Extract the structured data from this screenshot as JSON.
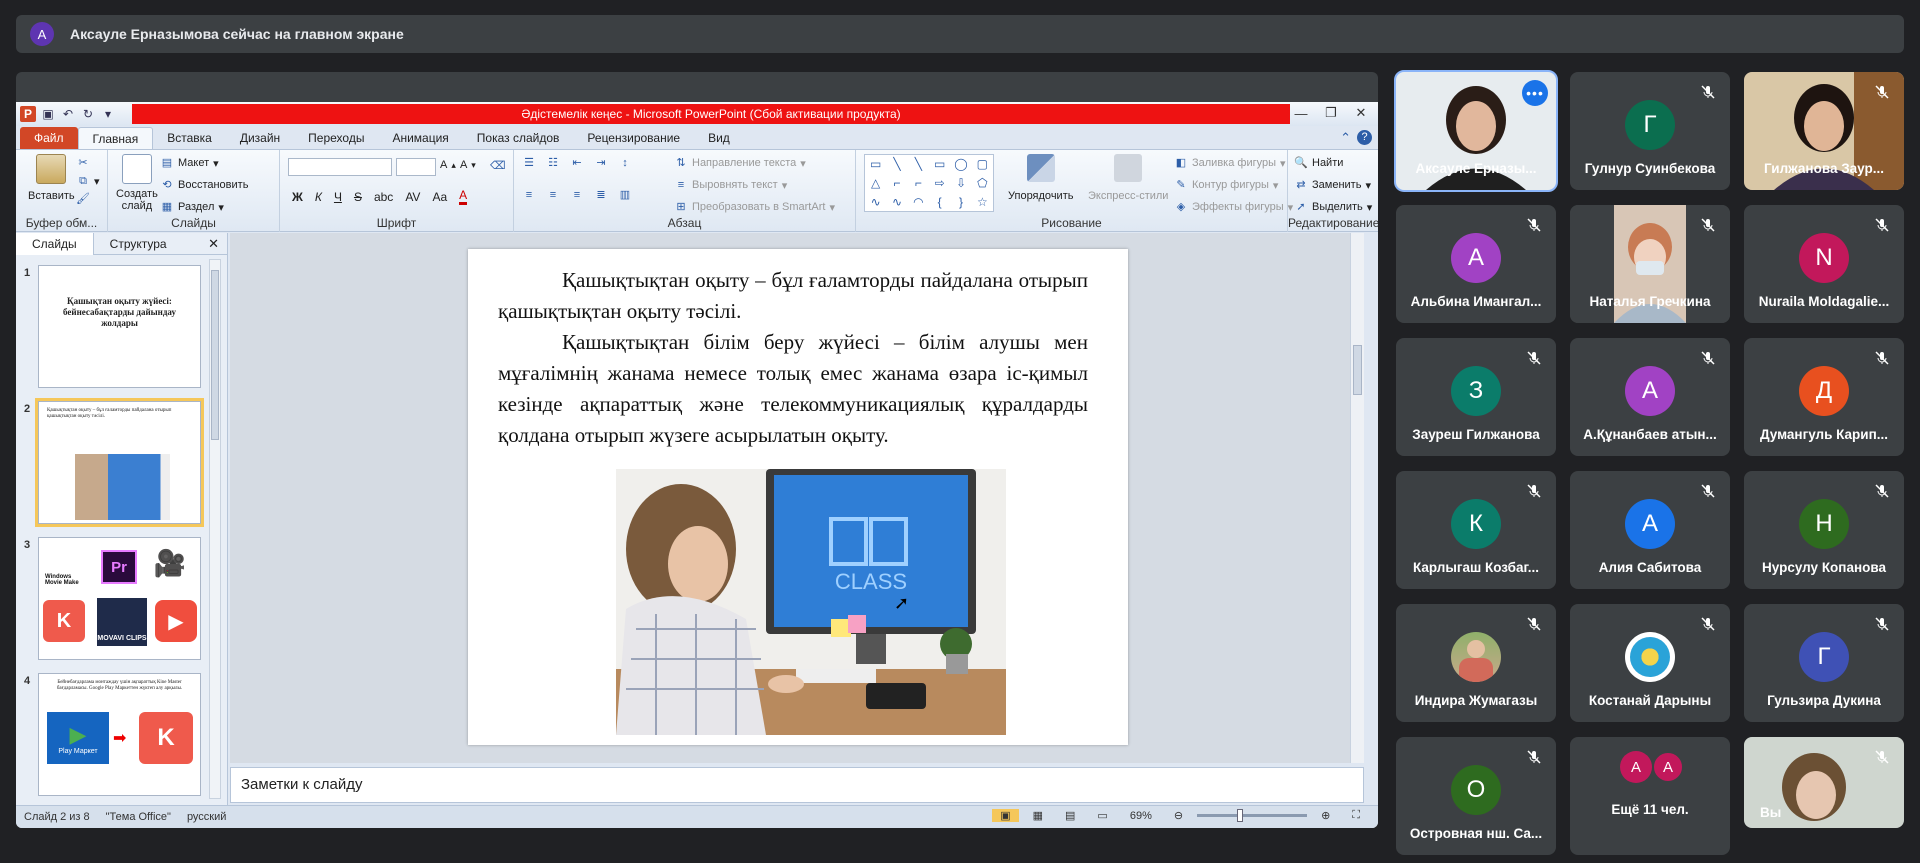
{
  "banner": {
    "avatar_letter": "А",
    "text": "Аксауле Ерназымова сейчас на главном экране"
  },
  "ppt": {
    "title": "Әдістемелік кеңес  -  Microsoft PowerPoint (Сбой активации продукта)",
    "tabs": [
      "Файл",
      "Главная",
      "Вставка",
      "Дизайн",
      "Переходы",
      "Анимация",
      "Показ слайдов",
      "Рецензирование",
      "Вид"
    ],
    "groups": {
      "clipboard": "Буфер обм...",
      "slides": "Слайды",
      "font": "Шрифт",
      "paragraph": "Абзац",
      "drawing": "Рисование",
      "editing": "Редактирование"
    },
    "buttons": {
      "paste": "Вставить",
      "new_slide_1": "Создать",
      "new_slide_2": "слайд",
      "layout": "Макет",
      "reset": "Восстановить",
      "section": "Раздел",
      "text_direction": "Направление текста",
      "align_text": "Выровнять текст",
      "smartart": "Преобразовать в SmartArt",
      "arrange": "Упорядочить",
      "quick_styles": "Экспресс-стили",
      "shape_fill": "Заливка фигуры",
      "shape_outline": "Контур фигуры",
      "shape_effects": "Эффекты фигуры",
      "find": "Найти",
      "replace": "Заменить",
      "select": "Выделить"
    },
    "format_glyphs": {
      "bold": "Ж",
      "italic": "К",
      "underline": "Ч",
      "strike": "S",
      "shadow": "abc",
      "spacing": "AV",
      "case": "Aa",
      "color": "A"
    },
    "pane_tabs": [
      "Слайды",
      "Структура"
    ],
    "thumbs": [
      {
        "num": "1",
        "title": "Қашықтан оқыту жүйесі: бейнесабақтарды дайындау жолдары"
      },
      {
        "num": "2",
        "title": "Қашықтықтан оқыту – бұл ғаламторды пайдалана отырып қашықтықтан оқыту тәсілі."
      },
      {
        "num": "3",
        "labels": [
          "Windows Movie Make",
          "Pr",
          "MOVAVI CLIPS"
        ]
      },
      {
        "num": "4",
        "title": "Бейнебағдарлама монтаждау үшін ақпараттық Кine Master бағдарламасы. Google Play Маркеттен жүктеп алу арқылы.",
        "store": "Play Маркет"
      }
    ],
    "slide": {
      "p1": "Қашықтықтан оқыту – бұл  ғаламторды пайдалана отырып қашықтықтан оқыту тәсілі.",
      "p2": "Қашықтықтан білім беру жүйесі – білім алушы мен мұғалімнің жанама немесе толық емес жанама өзара іс-қимыл кезінде ақпараттық және телекоммуникациялық құралдарды қолдана отырып жүзеге асырылатын оқыту.",
      "screen_word": "CLASS"
    },
    "notes_placeholder": "Заметки к слайду",
    "status": {
      "slide": "Слайд 2 из 8",
      "theme": "\"Тема Office\"",
      "lang": "русский",
      "zoom": "69%"
    }
  },
  "participants": [
    {
      "name": "Аксауле Ерназы...",
      "type": "video",
      "speaking": true
    },
    {
      "name": "Гулнур Суинбекова",
      "letter": "Г",
      "color": "#0b6e4f"
    },
    {
      "name": "Гилжанова Заур...",
      "type": "video"
    },
    {
      "name": "Альбина Имангал...",
      "letter": "А",
      "color": "#a142c4"
    },
    {
      "name": "Наталья Гречкина",
      "type": "video"
    },
    {
      "name": "Nuraila Moldagalie...",
      "letter": "N",
      "color": "#c2185b"
    },
    {
      "name": "Зауреш Гилжанова",
      "letter": "З",
      "color": "#0b7c6a"
    },
    {
      "name": "А.Құнанбаев атын...",
      "letter": "А",
      "color": "#a142c4"
    },
    {
      "name": "Думангуль Карип...",
      "letter": "Д",
      "color": "#e8501f"
    },
    {
      "name": "Карлыгаш Козбаг...",
      "letter": "К",
      "color": "#0b7c6a"
    },
    {
      "name": "Алия Сабитова",
      "letter": "А",
      "color": "#1a73e8"
    },
    {
      "name": "Нурсулу Копанова",
      "letter": "Н",
      "color": "#2e6b1f"
    },
    {
      "name": "Индира Жумагазы",
      "type": "photo"
    },
    {
      "name": "Костанай Дарыны",
      "type": "logo"
    },
    {
      "name": "Гульзира Дукина",
      "letter": "Г",
      "color": "#3f51b5"
    },
    {
      "name": "Островная нш. Са...",
      "letter": "О",
      "color": "#2e6b1f"
    },
    {
      "name": "Ещё 11 чел.",
      "type": "more",
      "letters": [
        "А",
        "А"
      ]
    },
    {
      "name": "Вы",
      "type": "video"
    }
  ]
}
